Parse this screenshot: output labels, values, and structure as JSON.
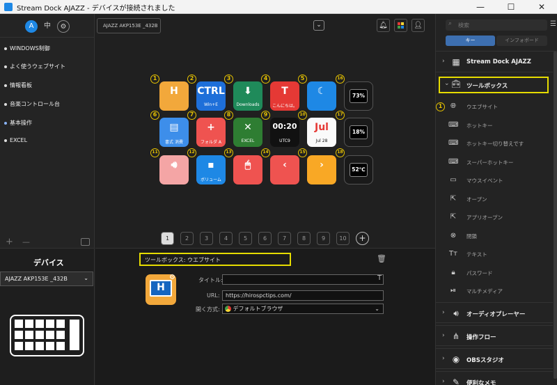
{
  "window": {
    "title": "Stream Dock AJAZZ - デバイスが接続されました"
  },
  "left_panel": {
    "items": [
      {
        "label": "WINDOWS制御",
        "active": false
      },
      {
        "label": "よく使うウェブサイト",
        "active": false
      },
      {
        "label": "情報看板",
        "active": false
      },
      {
        "label": "音楽コントロール台",
        "active": false
      },
      {
        "label": "基本操作",
        "active": true
      },
      {
        "label": "EXCEL",
        "active": false
      }
    ],
    "add_label": "+",
    "remove_label": "—"
  },
  "device": {
    "heading": "デバイス",
    "selected": "AJAZZ AKP153E _432B"
  },
  "center": {
    "device_tab": "AJAZZ AKP153E _432B",
    "keys": [
      {
        "n": "1",
        "label": "",
        "icon": "hiro-logo"
      },
      {
        "n": "2",
        "label": "Win+E",
        "icon": "ctrl-key"
      },
      {
        "n": "3",
        "label": "Downloads",
        "icon": "download-folder"
      },
      {
        "n": "4",
        "label": "こんにちは。",
        "icon": "text-t"
      },
      {
        "n": "5",
        "label": "",
        "icon": "sleep-moon"
      },
      {
        "n": "6",
        "label": "書式 消費",
        "icon": "format"
      },
      {
        "n": "7",
        "label": "フォルダ A",
        "icon": "add-folder"
      },
      {
        "n": "8",
        "label": "EXCEL",
        "icon": "excel"
      },
      {
        "n": "9",
        "label": "UTC9",
        "icon": "clock"
      },
      {
        "n": "10",
        "label": "Jul 28",
        "icon": "calendar"
      },
      {
        "n": "11",
        "label": "",
        "icon": "volume"
      },
      {
        "n": "12",
        "label": "ボリューム",
        "icon": "volume-mute"
      },
      {
        "n": "13",
        "label": "",
        "icon": "mouse"
      },
      {
        "n": "14",
        "label": "",
        "icon": "prev"
      },
      {
        "n": "15",
        "label": "",
        "icon": "next"
      }
    ],
    "knobs": [
      {
        "n": "16",
        "value": "73%"
      },
      {
        "n": "17",
        "value": "18%"
      },
      {
        "n": "18",
        "value": "52℃"
      }
    ],
    "clock_text": "00:20",
    "pages": [
      "1",
      "2",
      "3",
      "4",
      "5",
      "6",
      "7",
      "8",
      "9",
      "10"
    ],
    "current_page": "1",
    "add_page": "+"
  },
  "editor": {
    "header": "ツールボックス: ウエブサイト",
    "title_label": "タイトル:",
    "title_value": "",
    "url_label": "URL:",
    "url_value": "https://hirospctips.com/",
    "open_label": "開く方式:",
    "open_value": "デフォルトブラウザ",
    "text_icon": "T"
  },
  "right_panel": {
    "search_placeholder": "検索",
    "tab_keys": "キー",
    "tab_info": "インフォボード",
    "categories": [
      {
        "label": "Stream Dock AJAZZ",
        "icon": "keyboard-icon"
      },
      {
        "label": "ツールボックス",
        "icon": "toolbox-icon"
      }
    ],
    "actions": [
      {
        "label": "ウエブサイト",
        "icon": "globe-icon"
      },
      {
        "label": "ホットキー",
        "icon": "keyboard-icon"
      },
      {
        "label": "ホットキー切り替えです",
        "icon": "keyboard-switch-icon"
      },
      {
        "label": "スーパーホットキー",
        "icon": "super-key-icon"
      },
      {
        "label": "マウスイベント",
        "icon": "mouse-icon"
      },
      {
        "label": "オープン",
        "icon": "open-icon"
      },
      {
        "label": "アプリオープン",
        "icon": "app-open-icon"
      },
      {
        "label": "閉鎖",
        "icon": "close-circle-icon"
      },
      {
        "label": "テキスト",
        "icon": "text-icon"
      },
      {
        "label": "パスワード",
        "icon": "lock-icon"
      },
      {
        "label": "マルチメディア",
        "icon": "play-pause-icon"
      }
    ],
    "more_categories": [
      {
        "label": "オーディオプレーヤー",
        "icon": "speaker-icon"
      },
      {
        "label": "操作フロー",
        "icon": "flow-icon"
      },
      {
        "label": "OBSスタジオ",
        "icon": "obs-icon"
      },
      {
        "label": "便利なメモ",
        "icon": "memo-icon"
      }
    ],
    "badge_1": "1"
  },
  "colors": {
    "highlight": "#e6dc00",
    "accent": "#1e88e5",
    "badge": "#e6c200"
  }
}
